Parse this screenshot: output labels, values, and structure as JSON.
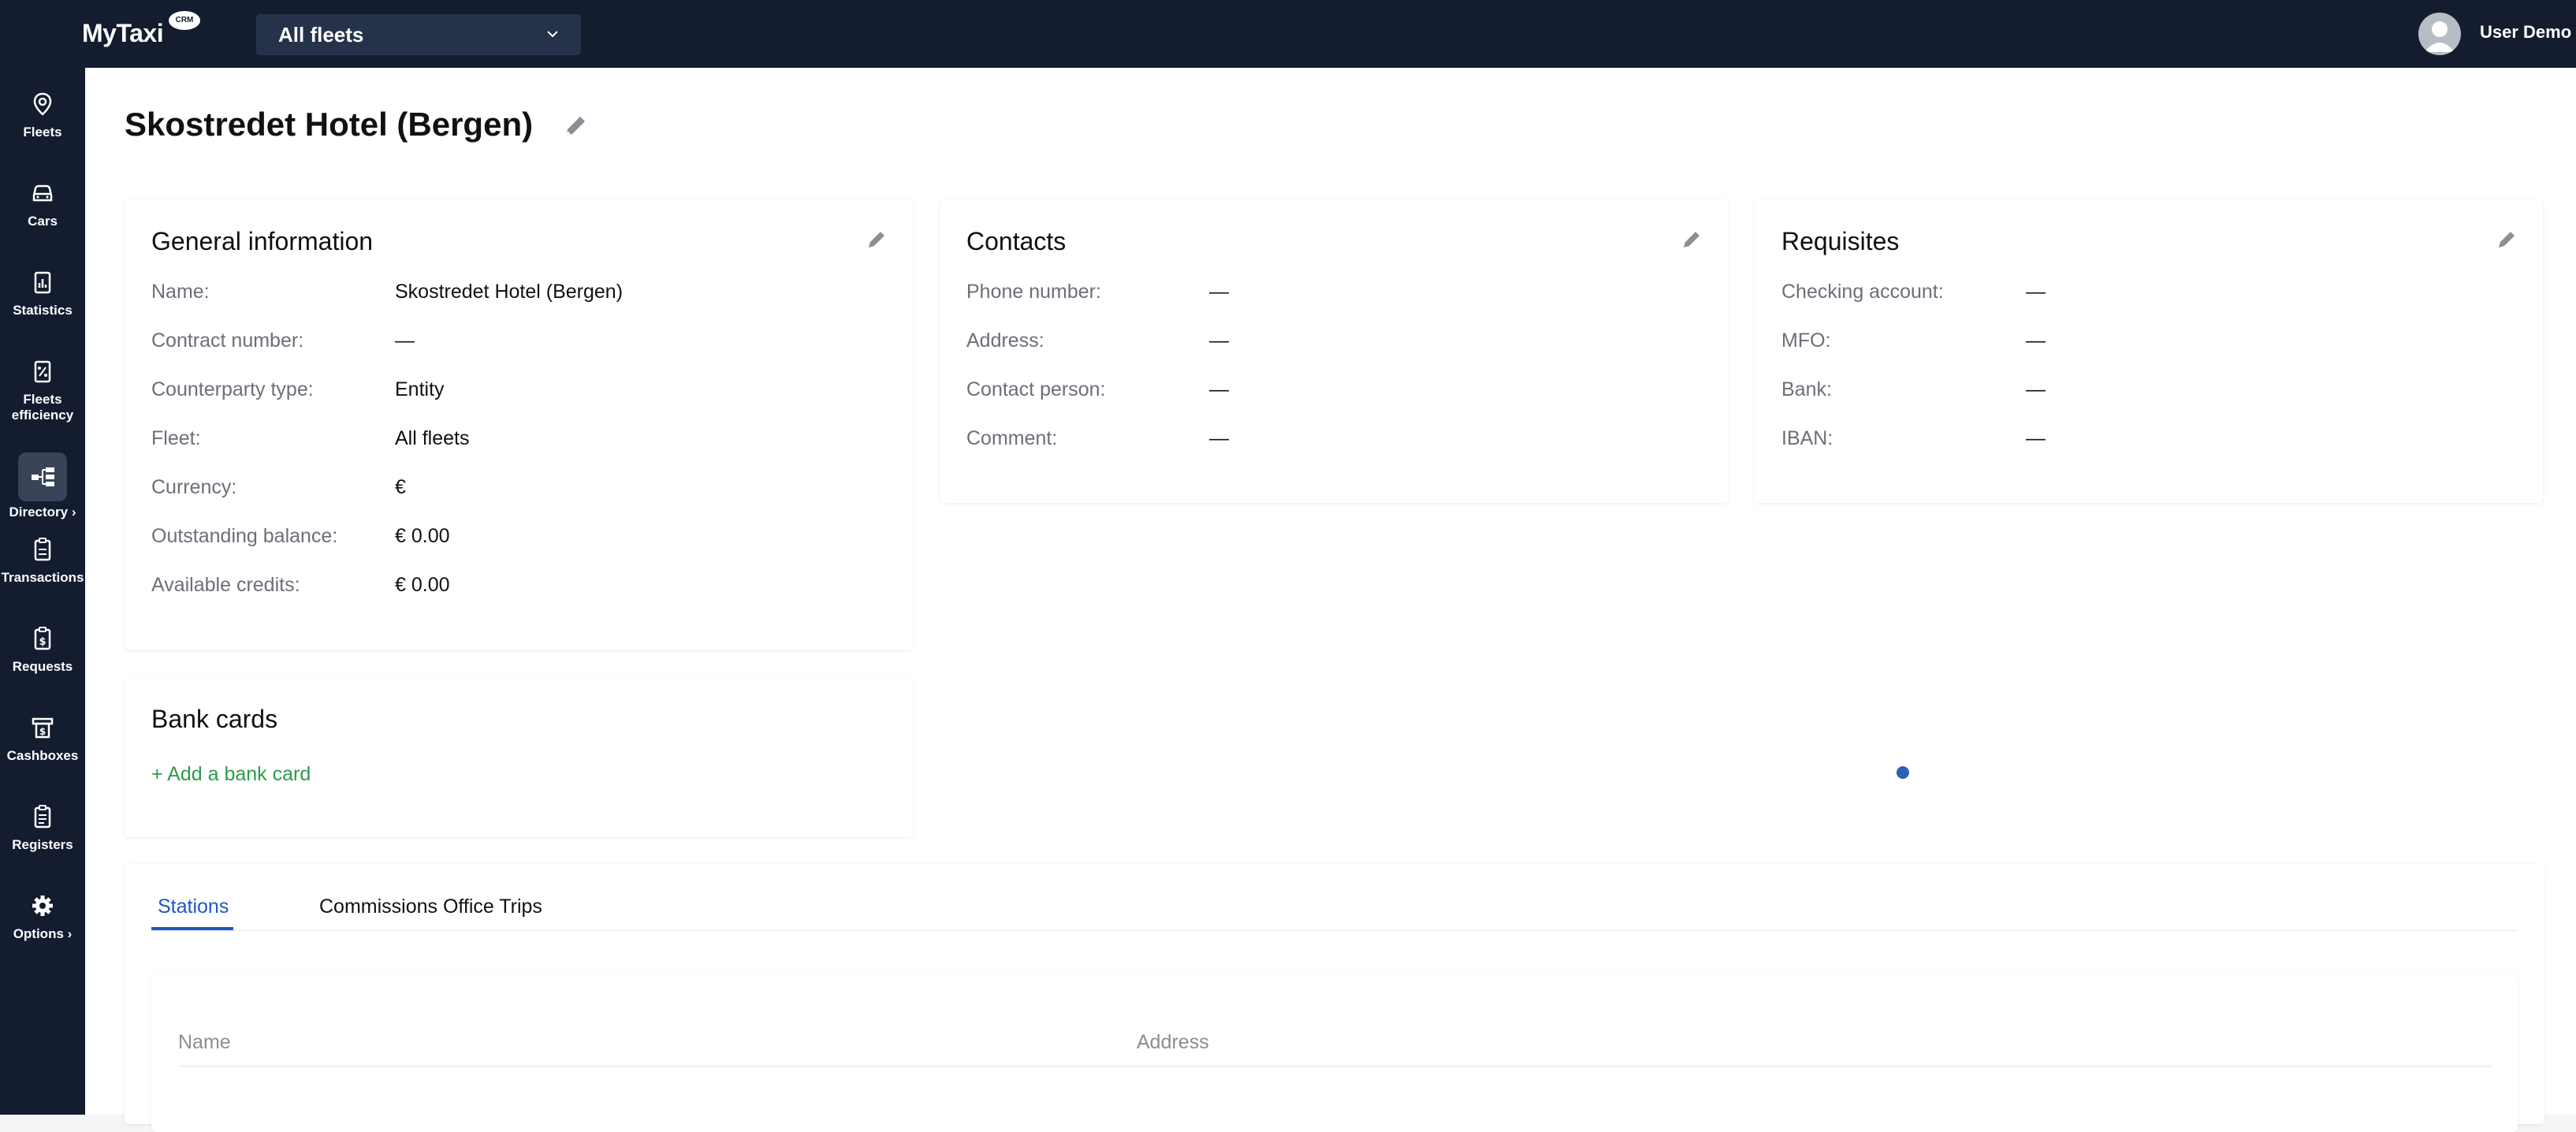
{
  "app": {
    "logo": "MyTaxi",
    "badge": "CRM"
  },
  "header": {
    "fleet_select": "All fleets",
    "user_name": "User Demo"
  },
  "sidebar": {
    "items": [
      {
        "label": "Fleets",
        "icon": "map-pin-icon"
      },
      {
        "label": "Cars",
        "icon": "car-icon"
      },
      {
        "label": "Statistics",
        "icon": "statistics-icon"
      },
      {
        "label": "Fleets efficiency",
        "icon": "percent-icon"
      },
      {
        "label": "Directory",
        "icon": "directory-icon",
        "active": true,
        "has_submenu": true
      },
      {
        "label": "Transactions",
        "icon": "clipboard-icon"
      },
      {
        "label": "Requests",
        "icon": "dollar-clipboard-icon"
      },
      {
        "label": "Cashboxes",
        "icon": "cashbox-icon"
      },
      {
        "label": "Registers",
        "icon": "register-icon"
      },
      {
        "label": "Options",
        "icon": "gear-icon",
        "has_submenu": true
      }
    ]
  },
  "page": {
    "title": "Skostredet Hotel (Bergen)"
  },
  "general": {
    "title": "General information",
    "rows": [
      {
        "label": "Name:",
        "value": "Skostredet Hotel (Bergen)"
      },
      {
        "label": "Contract number:",
        "value": "—"
      },
      {
        "label": "Counterparty type:",
        "value": "Entity"
      },
      {
        "label": "Fleet:",
        "value": "All fleets"
      },
      {
        "label": "Currency:",
        "value": "€"
      },
      {
        "label": "Outstanding balance:",
        "value": "€ 0.00"
      },
      {
        "label": "Available credits:",
        "value": "€ 0.00"
      }
    ]
  },
  "contacts": {
    "title": "Contacts",
    "rows": [
      {
        "label": "Phone number:",
        "value": "—"
      },
      {
        "label": "Address:",
        "value": "—"
      },
      {
        "label": "Contact person:",
        "value": "—"
      },
      {
        "label": "Comment:",
        "value": "—"
      }
    ]
  },
  "requisites": {
    "title": "Requisites",
    "rows": [
      {
        "label": "Checking account:",
        "value": "—"
      },
      {
        "label": "MFO:",
        "value": "—"
      },
      {
        "label": "Bank:",
        "value": "—"
      },
      {
        "label": "IBAN:",
        "value": "—"
      }
    ]
  },
  "bank_cards": {
    "title": "Bank cards",
    "add_label": "+ Add a bank card"
  },
  "tabs": [
    {
      "label": "Stations",
      "active": true
    },
    {
      "label": "Commissions Office Trips",
      "active": false
    }
  ],
  "table": {
    "columns": [
      "Name",
      "Address"
    ]
  },
  "colors": {
    "topbar": "#141c2f",
    "accent": "#2057c5",
    "link": "#2a9d4b"
  }
}
